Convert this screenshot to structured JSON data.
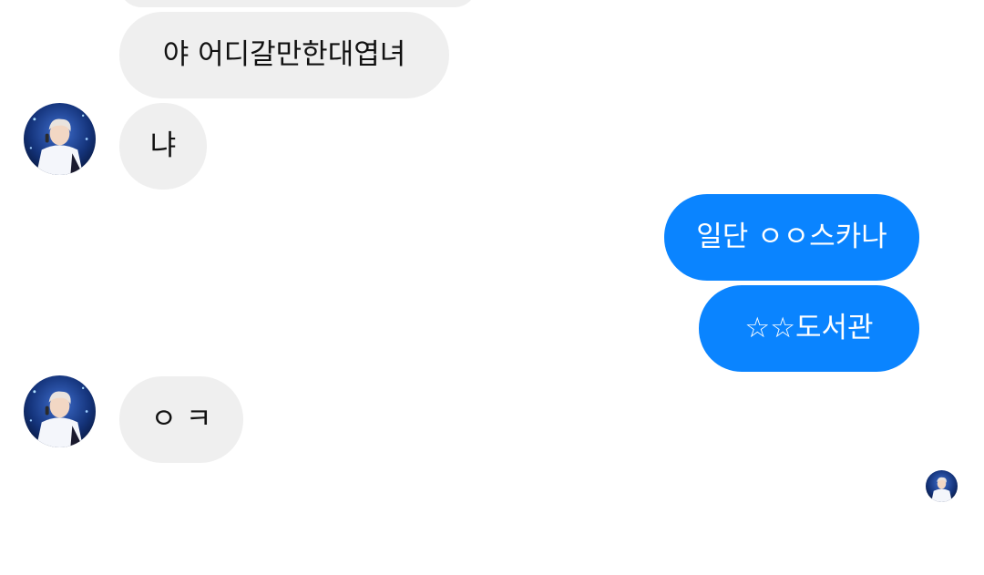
{
  "conversation": {
    "messages": [
      {
        "direction": "incoming",
        "text": "야 어디갈만한대엽녀"
      },
      {
        "direction": "incoming",
        "text": "냐"
      },
      {
        "direction": "outgoing",
        "text": "일단 ㅇㅇ스카나"
      },
      {
        "direction": "outgoing",
        "text": "☆☆도서관"
      },
      {
        "direction": "incoming",
        "text": "ㅇ ㅋ"
      }
    ],
    "seen_indicator": "avatar"
  },
  "colors": {
    "incoming_bubble": "#efefef",
    "outgoing_bubble": "#0a84ff",
    "background": "#ffffff"
  }
}
